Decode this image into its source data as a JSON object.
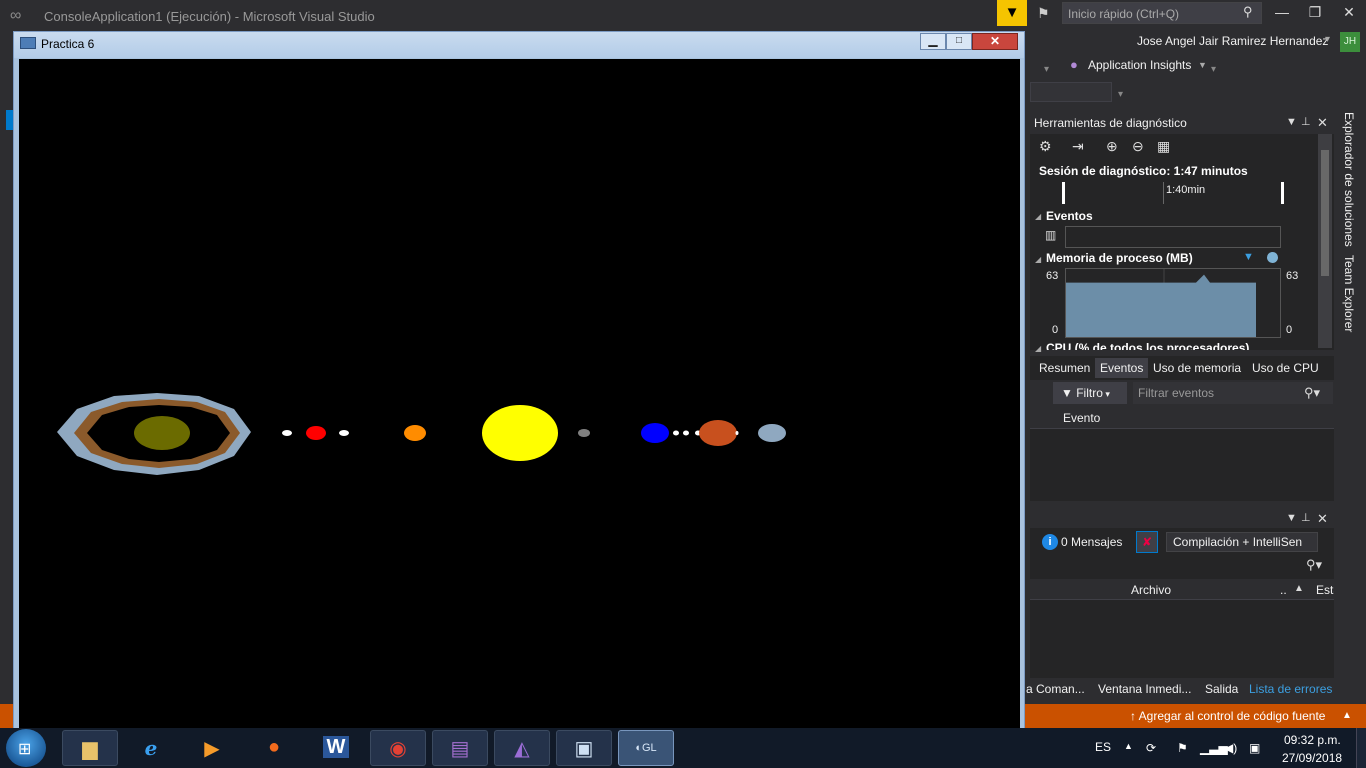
{
  "vs": {
    "title": "ConsoleApplication1 (Ejecución) - Microsoft Visual Studio",
    "quick_launch_placeholder": "Inicio rápido (Ctrl+Q)",
    "user_name": "Jose Angel Jair Ramirez Hernandez",
    "user_initials": "JH",
    "app_insights": "Application Insights"
  },
  "diagnostics": {
    "title": "Herramientas de diagnóstico",
    "session": "Sesión de diagnóstico: 1:47 minutos",
    "timeline_label": "1:40min",
    "events_header": "Eventos",
    "memory_header": "Memoria de proceso (MB)",
    "memory_max": "63",
    "memory_min": "0",
    "memory_level": 0.8,
    "cpu_header": "CPU (% de todos los procesadores)",
    "tabs": [
      "Resumen",
      "Eventos",
      "Uso de memoria",
      "Uso de CPU"
    ],
    "filter_label": "Filtro",
    "filter_placeholder": "Filtrar eventos",
    "events_column": "Evento"
  },
  "error_list": {
    "messages": "0 Mensajes",
    "build_filter": "Compilación + IntelliSen",
    "col_file": "Archivo",
    "col_dots": "..",
    "col_state": "Esta"
  },
  "bottom_tabs": [
    "a Coman...",
    "Ventana Inmedi...",
    "Salida",
    "Lista de errores"
  ],
  "vertical_tabs": [
    "Explorador de soluciones",
    "Team Explorer"
  ],
  "status_bar": {
    "text": "Agregar al control de código fuente"
  },
  "gl_window": {
    "title": "Practica 6",
    "background": "#000000"
  },
  "scene": {
    "bodies": [
      {
        "name": "ring-outer",
        "color": "#8fa8c0"
      },
      {
        "name": "ring-brown",
        "color": "#8b5a2b"
      },
      {
        "name": "saturn-core",
        "color": "#6b6b00"
      },
      {
        "name": "moon-1",
        "color": "#ffffff"
      },
      {
        "name": "mars",
        "color": "#ff0000"
      },
      {
        "name": "moon-2",
        "color": "#ffffff"
      },
      {
        "name": "venus",
        "color": "#ff8c00"
      },
      {
        "name": "sun",
        "color": "#ffff00"
      },
      {
        "name": "mercury",
        "color": "#808080"
      },
      {
        "name": "earth",
        "color": "#0000ff"
      },
      {
        "name": "jupiter",
        "color": "#c8501e"
      },
      {
        "name": "uranus",
        "color": "#8fa8c0"
      }
    ]
  },
  "taskbar": {
    "language": "ES",
    "time": "09:32 p.m.",
    "date": "27/09/2018",
    "apps": [
      "explorer",
      "internet-explorer",
      "media-player",
      "firefox",
      "word",
      "chrome",
      "winrar",
      "visual-studio",
      "console-app",
      "opengl-app"
    ]
  },
  "colors": {
    "vs_dark": "#2d2d30",
    "status_orange": "#ca5100",
    "accent_blue": "#007acc",
    "notify_yellow": "#f5c400"
  }
}
